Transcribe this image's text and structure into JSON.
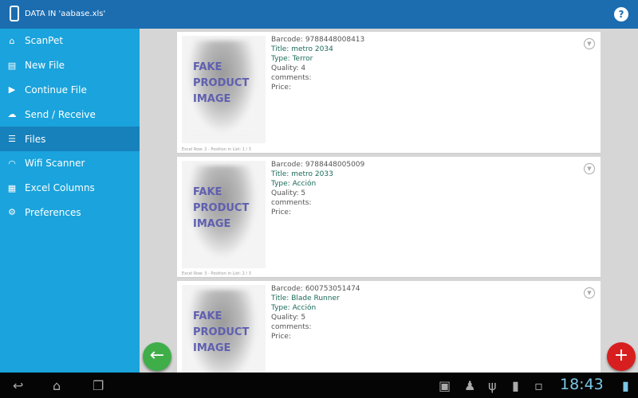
{
  "header": {
    "title": "DATA IN 'aabase.xls'",
    "help_icon": "help-icon"
  },
  "sidebar": {
    "items": [
      {
        "label": "ScanPet",
        "icon": "⌂"
      },
      {
        "label": "New File",
        "icon": "▤"
      },
      {
        "label": "Continue File",
        "icon": "▶"
      },
      {
        "label": "Send / Receive",
        "icon": "☁"
      },
      {
        "label": "Files",
        "icon": "☰",
        "selected": true
      },
      {
        "label": "Wifi Scanner",
        "icon": "◠"
      },
      {
        "label": "Excel Columns",
        "icon": "▦"
      },
      {
        "label": "Preferences",
        "icon": "⚙"
      }
    ]
  },
  "cards": [
    {
      "image_text": [
        "FAKE",
        "PRODUCT",
        "IMAGE"
      ],
      "barcode_label": "Barcode:",
      "barcode": "9788448008413",
      "title_label": "Title:",
      "title": "metro 2034",
      "type_label": "Type:",
      "type": "Terror",
      "quality_label": "Quality:",
      "quality": "4",
      "comments_label": "comments:",
      "price_label": "Price:",
      "footer": "Excel Row: 2  -  Position in List: 1 / 3"
    },
    {
      "image_text": [
        "FAKE",
        "PRODUCT",
        "IMAGE"
      ],
      "barcode_label": "Barcode:",
      "barcode": "9788448005009",
      "title_label": "Title:",
      "title": "metro 2033",
      "type_label": "Type:",
      "type": "Acción",
      "quality_label": "Quality:",
      "quality": "5",
      "comments_label": "comments:",
      "price_label": "Price:",
      "footer": "Excel Row: 3  -  Position in List: 2 / 3"
    },
    {
      "image_text": [
        "FAKE",
        "PRODUCT",
        "IMAGE"
      ],
      "barcode_label": "Barcode:",
      "barcode": "600753051474",
      "title_label": "Title:",
      "title": "Blade Runner",
      "type_label": "Type:",
      "type": "Acción",
      "quality_label": "Quality:",
      "quality": "5",
      "comments_label": "comments:",
      "price_label": "Price:",
      "footer": ""
    }
  ],
  "fab": {
    "back": "←",
    "add": "+",
    "back_color": "#3fae49",
    "add_color": "#d81f1f"
  },
  "statusbar": {
    "time": "18:43"
  }
}
